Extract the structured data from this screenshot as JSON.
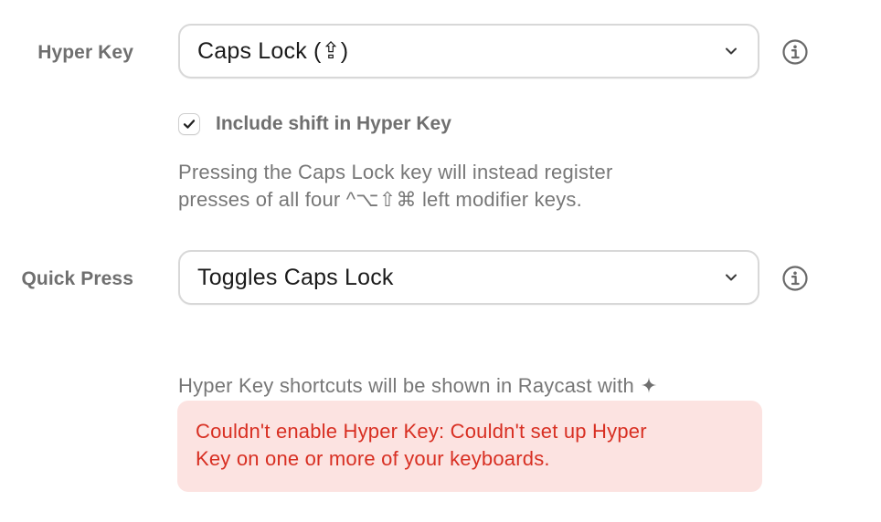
{
  "hyper_key": {
    "label": "Hyper Key",
    "select_value": "Caps Lock (⇪)",
    "include_shift_label": "Include shift in Hyper Key",
    "include_shift_checked": true,
    "description": "Pressing the Caps Lock key will instead register\npresses of all four ^⌥⇧⌘ left modifier keys."
  },
  "quick_press": {
    "label": "Quick Press",
    "select_value": "Toggles Caps Lock",
    "description": "Hyper Key shortcuts will be shown in Raycast with"
  },
  "error": {
    "message": "Couldn't enable Hyper Key: Couldn't set up Hyper\nKey on one or more of your keyboards."
  },
  "icons": {
    "dropdown": "chevron-down-icon",
    "info": "info-circle-icon",
    "checkbox": "checkmark-icon",
    "hyper": "sparkle-icon"
  },
  "colors": {
    "label": "#6f6f6f",
    "description": "#777777",
    "error_text": "#d82f22",
    "error_background": "#fce3e1",
    "border": "#d8d8d8"
  }
}
